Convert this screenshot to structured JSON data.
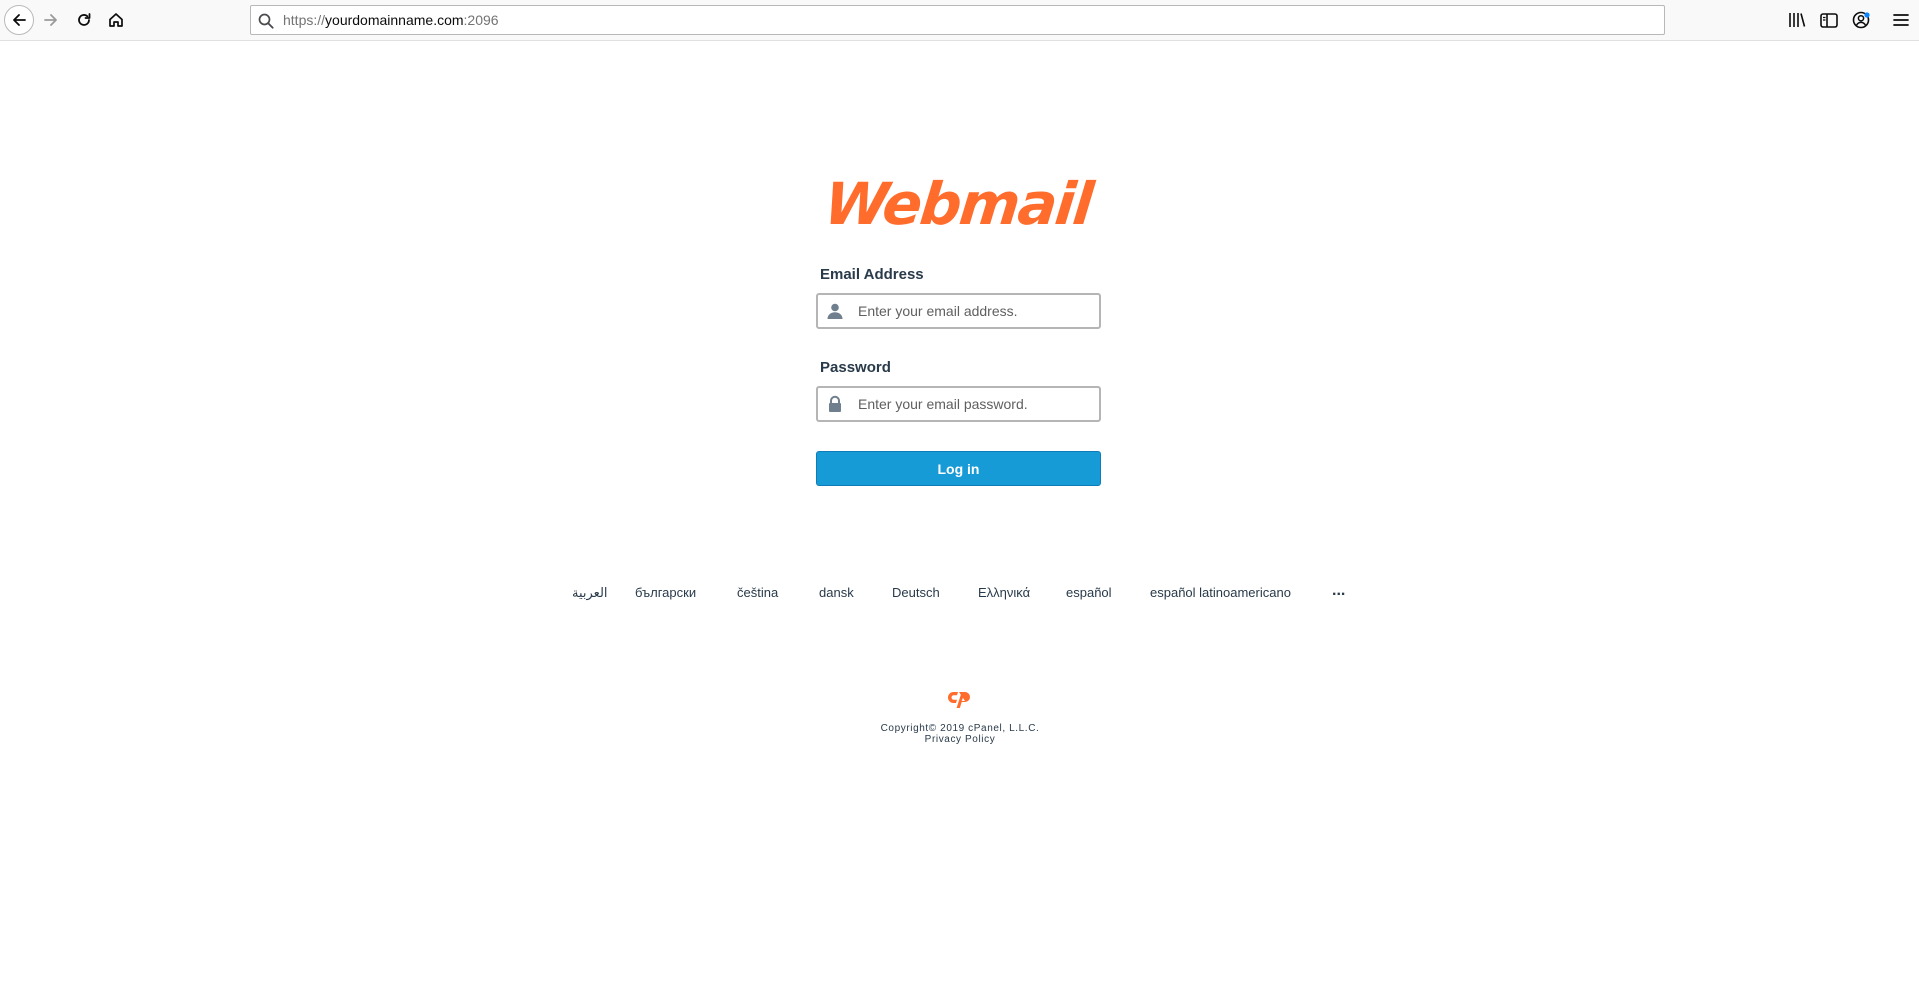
{
  "browser": {
    "url_protocol": "https://",
    "url_host": "yourdomainname.com",
    "url_port": ":2096"
  },
  "logo": {
    "text": "Webmail",
    "color": "#ff6c2c"
  },
  "form": {
    "email_label": "Email Address",
    "email_placeholder": "Enter your email address.",
    "email_value": "",
    "password_label": "Password",
    "password_placeholder": "Enter your email password.",
    "password_value": "",
    "login_label": "Log in",
    "login_color": "#179bd7"
  },
  "languages": {
    "items": [
      "العربية",
      "български",
      "čeština",
      "dansk",
      "Deutsch",
      "Ελληνικά",
      "español",
      "español latinoamericano"
    ],
    "more": "..."
  },
  "footer": {
    "copyright": "Copyright© 2019 cPanel, L.L.C.",
    "privacy": "Privacy Policy",
    "cpanel_logo_color": "#ff6c2c"
  }
}
